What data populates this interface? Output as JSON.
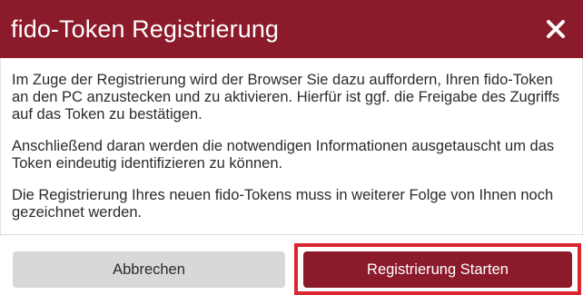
{
  "dialog": {
    "title": "fido-Token Registrierung",
    "close_icon": "close-icon",
    "paragraphs": [
      "Im Zuge der Registrierung wird der Browser Sie dazu auffordern, Ihren fido-Token an den PC anzustecken und zu aktivieren. Hierfür ist ggf. die Freigabe des Zugriffs auf das Token zu bestätigen.",
      "Anschließend daran werden die notwendigen Informationen ausgetauscht um das Token eindeutig identifizieren zu können.",
      "Die Registrierung Ihres neuen fido-Tokens muss in weiterer Folge von Ihnen noch gezeichnet werden."
    ],
    "buttons": {
      "cancel_label": "Abbrechen",
      "start_label": "Registrierung Starten"
    }
  },
  "colors": {
    "brand": "#8b1a2b",
    "highlight": "#d9262e",
    "cancel_bg": "#d8d8d8"
  }
}
